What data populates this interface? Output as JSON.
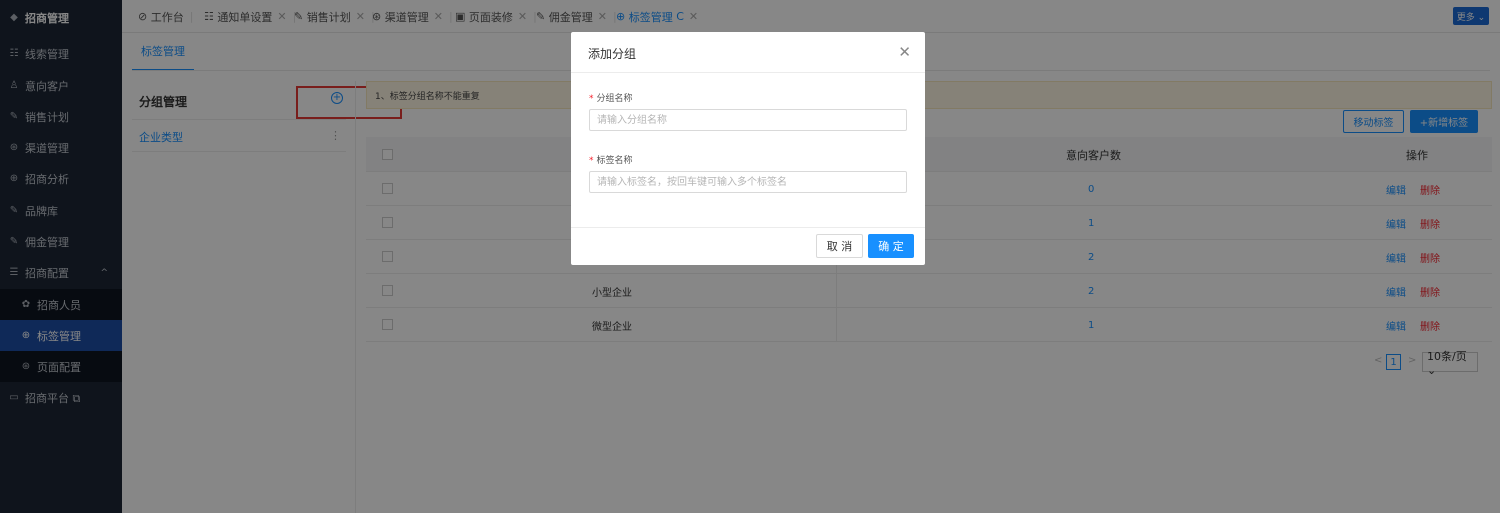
{
  "sidebar": {
    "brand": {
      "icon": "◆",
      "label": "招商管理"
    },
    "items": [
      {
        "icon": "☷",
        "label": "线索管理"
      },
      {
        "icon": "♙",
        "label": "意向客户"
      },
      {
        "icon": "✎",
        "label": "销售计划"
      },
      {
        "icon": "⊛",
        "label": "渠道管理"
      },
      {
        "icon": "⊕",
        "label": "招商分析"
      },
      {
        "icon": "✎",
        "label": "品牌库"
      },
      {
        "icon": "✎",
        "label": "佣金管理"
      },
      {
        "icon": "☰",
        "label": "招商配置",
        "arrow": "^"
      }
    ],
    "subitems": [
      {
        "icon": "✿",
        "label": "招商人员"
      },
      {
        "icon": "⊕",
        "label": "标签管理"
      },
      {
        "icon": "⊛",
        "label": "页面配置"
      }
    ],
    "platform": {
      "icon": "▭",
      "label": "招商平台 ⧉"
    }
  },
  "tabs": [
    {
      "icon": "⊘",
      "label": "工作台"
    },
    {
      "icon": "☷",
      "label": "通知单设置"
    },
    {
      "icon": "✎",
      "label": "销售计划"
    },
    {
      "icon": "⊛",
      "label": "渠道管理"
    },
    {
      "icon": "▣",
      "label": "页面装修"
    },
    {
      "icon": "✎",
      "label": "佣金管理"
    },
    {
      "icon": "⊕",
      "label": "标签管理",
      "refresh": "C"
    }
  ],
  "more_label": "更多 ⌄",
  "page_tab": "标签管理",
  "group_panel": {
    "title": "分组管理",
    "add_icon": "+",
    "item": "企业类型",
    "item_more": "⋮"
  },
  "notice": "1、标签分组名称不能重复",
  "buttons": {
    "move": "移动标签",
    "add": "+新增标签"
  },
  "table": {
    "headers": [
      "意向客户数",
      "操作"
    ],
    "rows": [
      {
        "name": "",
        "count": "0"
      },
      {
        "name": "",
        "count": "1"
      },
      {
        "name": "",
        "count": "2"
      },
      {
        "name": "小型企业",
        "count": "2"
      },
      {
        "name": "微型企业",
        "count": "1"
      }
    ],
    "edit": "编辑",
    "delete": "删除"
  },
  "pagination": {
    "prev": "<",
    "page": "1",
    "next": ">",
    "size": "10条/页 ⌄"
  },
  "modal": {
    "title": "添加分组",
    "close": "✕",
    "required_mark": "*",
    "group_label": "分组名称",
    "group_placeholder": "请输入分组名称",
    "tag_label": "标签名称",
    "tag_placeholder": "请输入标签名，按回车键可输入多个标签名",
    "cancel": "取 消",
    "ok": "确 定"
  },
  "colors": {
    "primary": "#1890ff",
    "danger": "#f5222d",
    "sidebar_bg": "#1d2736",
    "sidebar_active": "#1d4ea6",
    "highlight": "#e53935"
  }
}
